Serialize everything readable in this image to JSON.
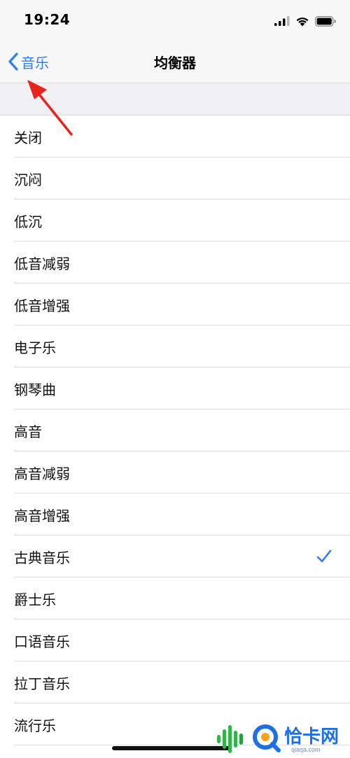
{
  "status_bar": {
    "time": "19:24"
  },
  "nav": {
    "back_label": "音乐",
    "title": "均衡器"
  },
  "eq_options": [
    {
      "label": "关闭"
    },
    {
      "label": "沉闷"
    },
    {
      "label": "低沉"
    },
    {
      "label": "低音减弱"
    },
    {
      "label": "低音增强"
    },
    {
      "label": "电子乐"
    },
    {
      "label": "钢琴曲"
    },
    {
      "label": "高音"
    },
    {
      "label": "高音减弱"
    },
    {
      "label": "高音增强"
    },
    {
      "label": "古典音乐",
      "selected": true
    },
    {
      "label": "爵士乐"
    },
    {
      "label": "口语音乐"
    },
    {
      "label": "拉丁音乐"
    },
    {
      "label": "流行乐"
    }
  ],
  "watermark": {
    "text": "恰卡网",
    "subtext": "qiaqa.com"
  },
  "colors": {
    "accent": "#2f7cf6",
    "annotation_arrow": "#e8231c",
    "background": "#ffffff",
    "group_background": "#efeff4"
  },
  "icons": {
    "signal": "cellular-signal-icon",
    "wifi": "wifi-icon",
    "battery": "battery-icon",
    "back": "chevron-left-icon",
    "check": "checkmark-icon"
  }
}
